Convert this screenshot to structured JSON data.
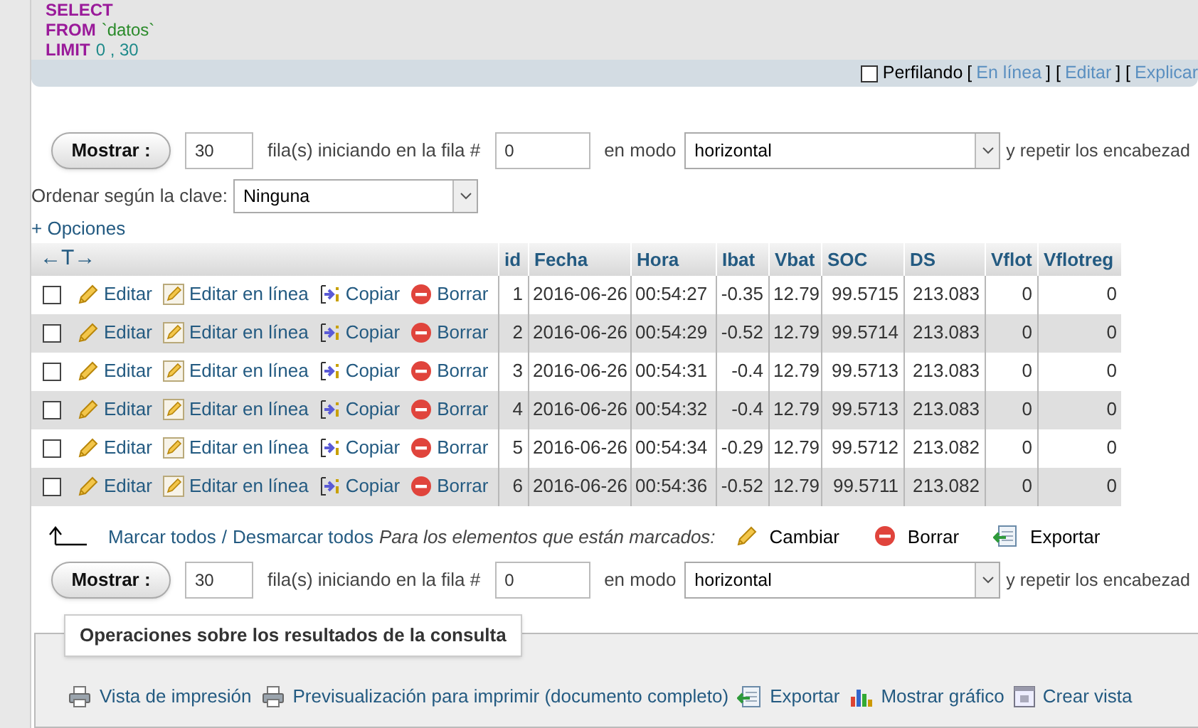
{
  "sql": {
    "lines": [
      {
        "keyword": "SELECT"
      },
      {
        "keyword": "FROM",
        "arg": "`datos`",
        "kind": "string"
      },
      {
        "keyword": "LIMIT",
        "arg": "0 , 30",
        "kind": "number"
      }
    ]
  },
  "profiling": {
    "checkbox": {
      "label": "Perfilando",
      "checked": false
    },
    "items": [
      {
        "text": "[",
        "kind": "plain"
      },
      {
        "text": "En línea",
        "kind": "link"
      },
      {
        "text": "] [",
        "kind": "plain"
      },
      {
        "text": "Editar",
        "kind": "link"
      },
      {
        "text": "] [",
        "kind": "plain"
      },
      {
        "text": "Explicar",
        "kind": "link"
      }
    ]
  },
  "navigation_top": {
    "button": "Mostrar :",
    "rows": "30",
    "label_rows": "fila(s) iniciando en la fila #",
    "start": "0",
    "label_mode": "en modo",
    "mode": "horizontal",
    "label_repeat": "y repetir los encabezad"
  },
  "sort": {
    "label": "Ordenar según la clave:",
    "value": "Ninguna"
  },
  "options_link": "+ Opciones",
  "table": {
    "corner": "←T→",
    "columns": [
      "id",
      "Fecha",
      "Hora",
      "Ibat",
      "Vbat",
      "SOC",
      "DS",
      "Vflot",
      "Vflotreg"
    ],
    "rows": [
      {
        "selected": false,
        "actions": [
          "Editar",
          "Editar en línea",
          "Copiar",
          "Borrar"
        ],
        "cells": [
          "1",
          "2016-06-26",
          "00:54:27",
          "-0.35",
          "12.79",
          "99.5715",
          "213.083",
          "0",
          "0"
        ]
      },
      {
        "selected": false,
        "actions": [
          "Editar",
          "Editar en línea",
          "Copiar",
          "Borrar"
        ],
        "cells": [
          "2",
          "2016-06-26",
          "00:54:29",
          "-0.52",
          "12.79",
          "99.5714",
          "213.083",
          "0",
          "0"
        ]
      },
      {
        "selected": false,
        "actions": [
          "Editar",
          "Editar en línea",
          "Copiar",
          "Borrar"
        ],
        "cells": [
          "3",
          "2016-06-26",
          "00:54:31",
          "-0.4",
          "12.79",
          "99.5713",
          "213.083",
          "0",
          "0"
        ]
      },
      {
        "selected": false,
        "actions": [
          "Editar",
          "Editar en línea",
          "Copiar",
          "Borrar"
        ],
        "cells": [
          "4",
          "2016-06-26",
          "00:54:32",
          "-0.4",
          "12.79",
          "99.5713",
          "213.083",
          "0",
          "0"
        ]
      },
      {
        "selected": false,
        "actions": [
          "Editar",
          "Editar en línea",
          "Copiar",
          "Borrar"
        ],
        "cells": [
          "5",
          "2016-06-26",
          "00:54:34",
          "-0.29",
          "12.79",
          "99.5712",
          "213.082",
          "0",
          "0"
        ]
      },
      {
        "selected": false,
        "actions": [
          "Editar",
          "Editar en línea",
          "Copiar",
          "Borrar"
        ],
        "cells": [
          "6",
          "2016-06-26",
          "00:54:36",
          "-0.52",
          "12.79",
          "99.5711",
          "213.082",
          "0",
          "0"
        ]
      }
    ]
  },
  "bulk": {
    "check_all": "Marcar todos",
    "separator": "/",
    "uncheck_all": "Desmarcar todos",
    "with_selected": "Para los elementos que están marcados:",
    "buttons": [
      {
        "label": "Cambiar",
        "kind": "edit"
      },
      {
        "label": "Borrar",
        "kind": "delete"
      },
      {
        "label": "Exportar",
        "kind": "export"
      }
    ]
  },
  "navigation_bottom": {
    "button": "Mostrar :",
    "rows": "30",
    "label_rows": "fila(s) iniciando en la fila #",
    "start": "0",
    "label_mode": "en modo",
    "mode": "horizontal",
    "label_repeat": "y repetir los encabezad"
  },
  "operations": {
    "legend": "Operaciones sobre los resultados de la consulta",
    "links": [
      {
        "label": "Vista de impresión",
        "kind": "print"
      },
      {
        "label": "Previsualización para imprimir (documento completo)",
        "kind": "print"
      },
      {
        "label": "Exportar",
        "kind": "export"
      },
      {
        "label": "Mostrar gráfico",
        "kind": "chart"
      },
      {
        "label": "Crear vista",
        "kind": "view"
      }
    ]
  }
}
